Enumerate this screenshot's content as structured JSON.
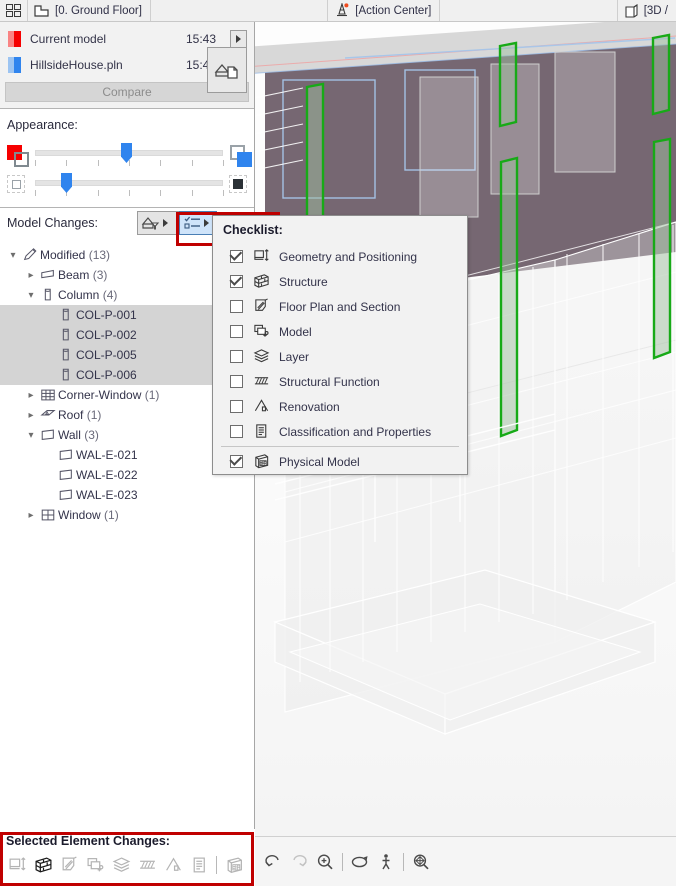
{
  "tabbar": {
    "grid_icon": "grid-icon",
    "floorplan_tab": "[0. Ground Floor]",
    "action_center_tab": "[Action Center]",
    "threed_tab": "[3D /"
  },
  "models": {
    "rows": [
      {
        "name": "Current model",
        "time": "15:43",
        "color_light": "#f98484",
        "color_solid": "#f60000"
      },
      {
        "name": "HillsideHouse.pln",
        "time": "15:43",
        "color_light": "#9cc4f2",
        "color_solid": "#2f84ee"
      }
    ],
    "compare_label": "Compare"
  },
  "appearance": {
    "title": "Appearance:",
    "slider_top_value": 52,
    "slider_bottom_value": 16
  },
  "model_changes": {
    "label": "Model Changes:",
    "filter_button": "filter-house-icon",
    "checklist_button": "checklist-icon"
  },
  "checklist": {
    "title": "Checklist:",
    "items": [
      {
        "label": "Geometry and Positioning",
        "checked": true,
        "icon": "geometry-icon"
      },
      {
        "label": "Structure",
        "checked": true,
        "icon": "structure-icon"
      },
      {
        "label": "Floor Plan and Section",
        "checked": false,
        "icon": "floorplan-section-icon"
      },
      {
        "label": "Model",
        "checked": false,
        "icon": "model-icon"
      },
      {
        "label": "Layer",
        "checked": false,
        "icon": "layer-icon"
      },
      {
        "label": "Structural Function",
        "checked": false,
        "icon": "structural-function-icon"
      },
      {
        "label": "Renovation",
        "checked": false,
        "icon": "renovation-icon"
      },
      {
        "label": "Classification and Properties",
        "checked": false,
        "icon": "classification-icon"
      }
    ],
    "footer_item": {
      "label": "Physical Model",
      "checked": true,
      "icon": "physical-model-icon"
    }
  },
  "tree": [
    {
      "depth": 0,
      "twisty": "down",
      "icon": "pencil-icon",
      "label": "Modified",
      "count": "(13)",
      "selected": false
    },
    {
      "depth": 1,
      "twisty": "right",
      "icon": "beam-icon",
      "label": "Beam",
      "count": "(3)",
      "selected": false
    },
    {
      "depth": 1,
      "twisty": "down",
      "icon": "column-icon",
      "label": "Column",
      "count": "(4)",
      "selected": false
    },
    {
      "depth": 2,
      "twisty": "",
      "icon": "column-icon",
      "label": "COL-P-001",
      "count": "",
      "selected": true
    },
    {
      "depth": 2,
      "twisty": "",
      "icon": "column-icon",
      "label": "COL-P-002",
      "count": "",
      "selected": true
    },
    {
      "depth": 2,
      "twisty": "",
      "icon": "column-icon",
      "label": "COL-P-005",
      "count": "",
      "selected": true
    },
    {
      "depth": 2,
      "twisty": "",
      "icon": "column-icon",
      "label": "COL-P-006",
      "count": "",
      "selected": true
    },
    {
      "depth": 1,
      "twisty": "right",
      "icon": "corner-window-icon",
      "label": "Corner-Window",
      "count": "(1)",
      "selected": false
    },
    {
      "depth": 1,
      "twisty": "right",
      "icon": "roof-icon",
      "label": "Roof",
      "count": "(1)",
      "selected": false
    },
    {
      "depth": 1,
      "twisty": "down",
      "icon": "wall-icon",
      "label": "Wall",
      "count": "(3)",
      "selected": false
    },
    {
      "depth": 2,
      "twisty": "",
      "icon": "wall-icon",
      "label": "WAL-E-021",
      "count": "",
      "selected": false
    },
    {
      "depth": 2,
      "twisty": "",
      "icon": "wall-icon",
      "label": "WAL-E-022",
      "count": "",
      "selected": false
    },
    {
      "depth": 2,
      "twisty": "",
      "icon": "wall-icon",
      "label": "WAL-E-023",
      "count": "",
      "selected": false
    },
    {
      "depth": 1,
      "twisty": "right",
      "icon": "window-icon",
      "label": "Window",
      "count": "(1)",
      "selected": false
    }
  ],
  "selected_element_changes": {
    "title": "Selected Element Changes:",
    "icons": [
      {
        "name": "geometry-icon",
        "active": false
      },
      {
        "name": "structure-icon",
        "active": true
      },
      {
        "name": "floorplan-section-icon",
        "active": false
      },
      {
        "name": "model-icon",
        "active": false
      },
      {
        "name": "layer-icon",
        "active": false
      },
      {
        "name": "structural-function-icon",
        "active": false
      },
      {
        "name": "renovation-icon",
        "active": false
      },
      {
        "name": "classification-icon",
        "active": false
      },
      {
        "name": "physical-model-icon",
        "active": false
      }
    ]
  },
  "viewport_toolbar": {
    "icons": [
      {
        "name": "orbit-left-icon",
        "disabled": false
      },
      {
        "name": "orbit-right-icon",
        "disabled": true
      },
      {
        "name": "zoom-in-icon",
        "disabled": false
      },
      {
        "name": "orbit-icon",
        "disabled": false
      },
      {
        "name": "walk-icon",
        "disabled": false
      },
      {
        "name": "fit-in-window-icon",
        "disabled": false
      }
    ]
  },
  "colors": {
    "accent_blue": "#2f84ee",
    "accent_red": "#f60000",
    "annotation_red": "#c00000",
    "highlight_green": "#17aa17",
    "selection_gray": "#d4d4d4"
  }
}
